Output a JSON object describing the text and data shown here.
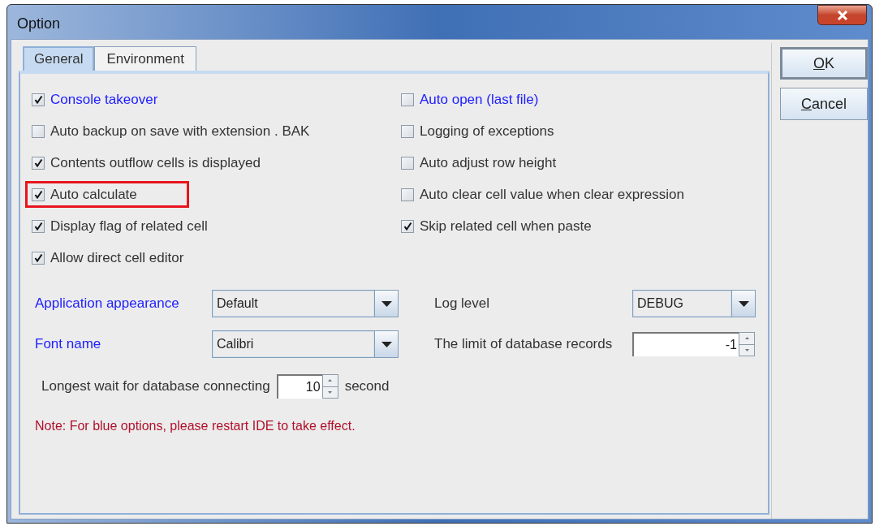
{
  "window": {
    "title": "Option"
  },
  "tabs": [
    {
      "label": "General",
      "selected": true
    },
    {
      "label": "Environment",
      "selected": false
    }
  ],
  "options": [
    {
      "label": "Console takeover",
      "checked": true,
      "restart_required": true,
      "highlighted": false
    },
    {
      "label": "Auto open (last file)",
      "checked": false,
      "restart_required": true,
      "highlighted": false
    },
    {
      "label": "Auto backup on save with extension . BAK",
      "checked": false,
      "restart_required": false,
      "highlighted": false
    },
    {
      "label": "Logging of exceptions",
      "checked": false,
      "restart_required": false,
      "highlighted": false
    },
    {
      "label": "Contents outflow cells is displayed",
      "checked": true,
      "restart_required": false,
      "highlighted": false
    },
    {
      "label": "Auto adjust row height",
      "checked": false,
      "restart_required": false,
      "highlighted": false
    },
    {
      "label": "Auto calculate",
      "checked": true,
      "restart_required": false,
      "highlighted": true
    },
    {
      "label": "Auto clear cell value when clear expression",
      "checked": false,
      "restart_required": false,
      "highlighted": false
    },
    {
      "label": "Display flag of related cell",
      "checked": true,
      "restart_required": false,
      "highlighted": false
    },
    {
      "label": "Skip related cell when paste",
      "checked": true,
      "restart_required": false,
      "highlighted": false
    },
    {
      "label": "Allow direct cell editor",
      "checked": true,
      "restart_required": false,
      "highlighted": false
    }
  ],
  "settings": [
    {
      "label": "Application appearance",
      "kind": "dropdown",
      "value": "Default",
      "restart_required": true
    },
    {
      "label": "Log level",
      "kind": "dropdown",
      "value": "DEBUG",
      "restart_required": false
    },
    {
      "label": "Font name",
      "kind": "dropdown",
      "value": "Calibri",
      "restart_required": true
    },
    {
      "label": "The limit of database records",
      "kind": "spinner",
      "value": "-1",
      "restart_required": false
    }
  ],
  "wait": {
    "label": "Longest wait for database connecting",
    "value": "10",
    "unit": "second"
  },
  "note": "Note: For blue options, please restart IDE to take effect.",
  "buttons": [
    {
      "label": "OK",
      "default": true
    },
    {
      "label": "Cancel",
      "default": false
    }
  ]
}
